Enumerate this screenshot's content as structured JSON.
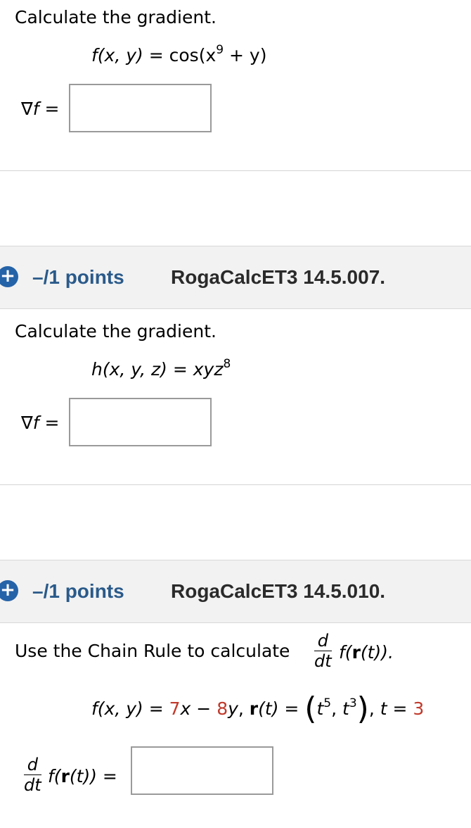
{
  "q1": {
    "prompt": "Calculate the gradient.",
    "func": {
      "lhs": "f(x, y)",
      "eq": " = cos(x",
      "exp": "9",
      "rest": " + y)"
    },
    "answer_label": "∇f =",
    "answer_value": ""
  },
  "q2": {
    "points": "–/1 points",
    "id": "RogaCalcET3 14.5.007.",
    "prompt": "Calculate the gradient.",
    "func": {
      "lhs": "h(x, y, z)",
      "eq": " = ",
      "rhs": "xyz",
      "exp": "8"
    },
    "answer_label": "∇f =",
    "answer_value": ""
  },
  "q3": {
    "points": "–/1 points",
    "id": "RogaCalcET3 14.5.010.",
    "prompt": "Use the Chain Rule to calculate",
    "d": "d",
    "dt": "dt",
    "expr_suffix": "f(r(t)).",
    "f_lhs": "f(x, y)",
    "coef_x": "7",
    "x_var": "x",
    "minus": " − ",
    "coef_y": "8",
    "y_var": "y",
    "r_label": "r(t)",
    "t5": "t",
    "exp5": "5",
    "t3": "t",
    "exp3": "3",
    "t_label": "t",
    "t_value": "3",
    "answer_expr": "f(r(t)) =",
    "answer_value": ""
  },
  "colors": {
    "accent": "#2563a8",
    "given_value": "#c0392b"
  }
}
